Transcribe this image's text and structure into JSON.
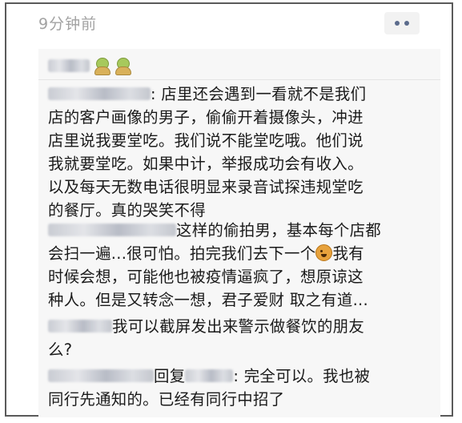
{
  "header": {
    "timestamp": "9分钟前",
    "more_icon": "more-dots-icon"
  },
  "likes": {
    "icons": [
      "thumbs-up-emoji-icon",
      "thumbs-up-emoji-icon"
    ]
  },
  "comments": [
    {
      "author_blurred": true,
      "separator": ": ",
      "lines": [
        "店里还会遇到一看就不是我们",
        "店的客户画像的男子，偷偷开着摄像头，冲进",
        "店里说我要堂吃。我们说不能堂吃哦。他们说",
        "我就要堂吃。如果中计，举报成功会有收入。",
        "以及每天无数电话很明显来录音试探违规堂吃",
        "的餐厅。真的哭笑不得"
      ]
    },
    {
      "author_blurred": true,
      "lines": [
        "这样的偷拍男，基本每个店都",
        "会扫一遍...很可怕。拍完我们去下一个",
        "我有",
        "时候会想，可能他也被疫情逼疯了，想原谅这",
        "种人。但是又转念一想，君子爱财 取之有道..."
      ],
      "emoji": "wink-emoji-icon"
    },
    {
      "author_blurred": true,
      "lines": [
        "我可以截屏发出来警示做餐饮的朋友",
        "么?"
      ]
    },
    {
      "author_blurred": true,
      "reply_word": "回复",
      "separator": ": ",
      "lines": [
        "完全可以。我也被",
        "同行先通知的。已经有同行中招了"
      ]
    }
  ]
}
